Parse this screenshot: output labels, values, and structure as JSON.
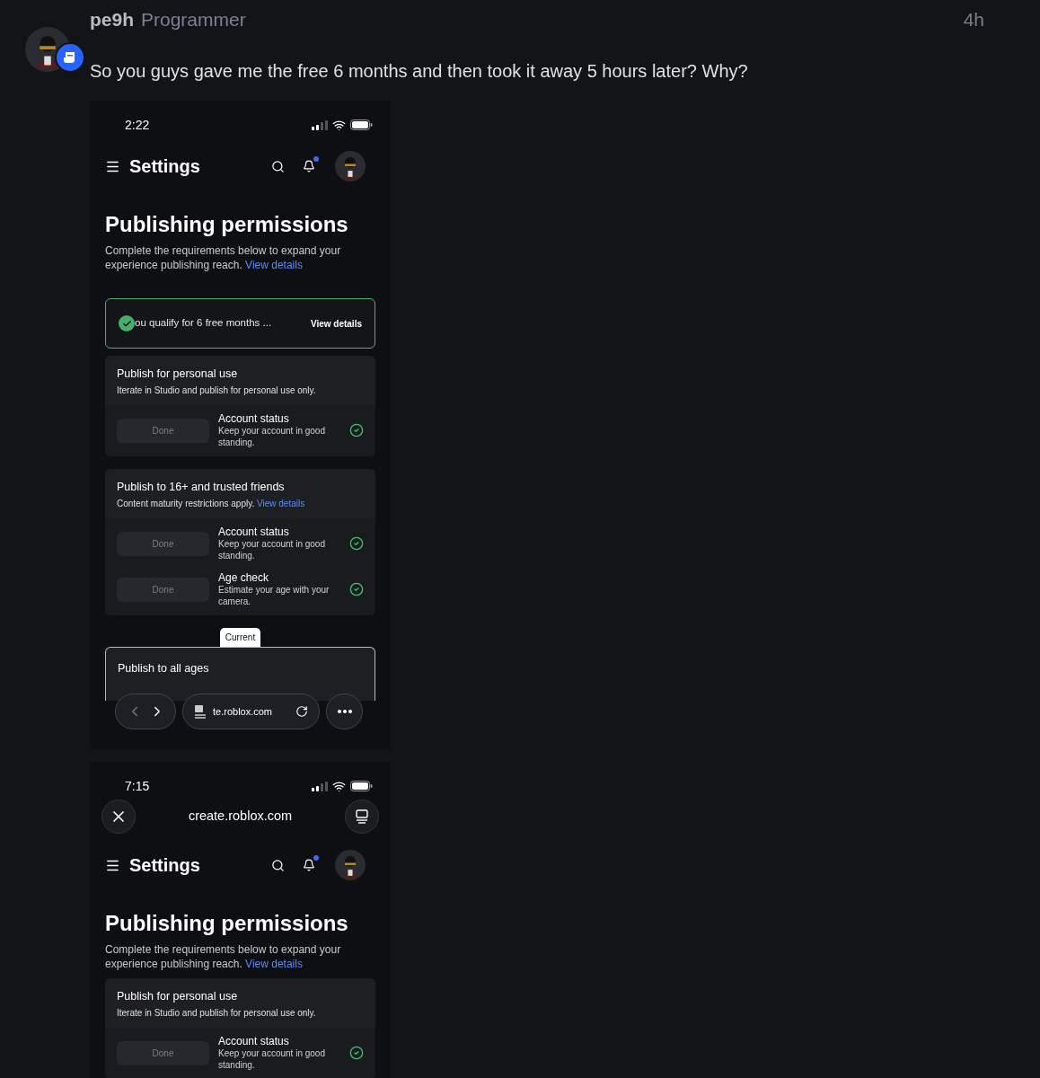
{
  "post": {
    "author": "pe9h",
    "role": "Programmer",
    "time": "4h",
    "message": "So you guys gave me the free 6 months and then took it away 5 hours later? Why?"
  },
  "screenshots": [
    {
      "status_bar": {
        "time": "2:22"
      },
      "header": {
        "title": "Settings",
        "notification_dot": true
      },
      "page": {
        "heading": "Publishing permissions",
        "description": "Complete the requirements below to expand your experience publishing reach.",
        "link": "View details"
      },
      "banner": {
        "text": "ou qualify for 6 free months ...",
        "action": "View details"
      },
      "sections": [
        {
          "title": "Publish for personal use",
          "subtitle": "Iterate in Studio and publish for personal use only.",
          "requirements": [
            {
              "button": "Done",
              "title": "Account status",
              "description": "Keep your account in good standing.",
              "done": true
            }
          ]
        },
        {
          "title": "Publish to 16+ and trusted friends",
          "subtitle": "Content maturity restrictions apply.",
          "link": "View details",
          "requirements": [
            {
              "button": "Done",
              "title": "Account status",
              "description": "Keep your account in good standing.",
              "done": true
            },
            {
              "button": "Done",
              "title": "Age check",
              "description": "Estimate your age with your camera.",
              "done": true
            }
          ]
        }
      ],
      "current_section": {
        "badge": "Current",
        "title": "Publish to all ages"
      },
      "browser_bottom": {
        "url": "te.roblox.com"
      }
    },
    {
      "status_bar": {
        "time": "7:15"
      },
      "browser_top": {
        "url": "create.roblox.com"
      },
      "header": {
        "title": "Settings",
        "notification_dot": true
      },
      "page": {
        "heading": "Publishing permissions",
        "description": "Complete the requirements below to expand your experience publishing reach.",
        "link": "View details"
      },
      "sections": [
        {
          "title": "Publish for personal use",
          "subtitle": "Iterate in Studio and publish for personal use only.",
          "requirements": [
            {
              "button": "Done",
              "title": "Account status",
              "description": "Keep your account in good standing.",
              "done": true
            }
          ]
        }
      ]
    }
  ]
}
